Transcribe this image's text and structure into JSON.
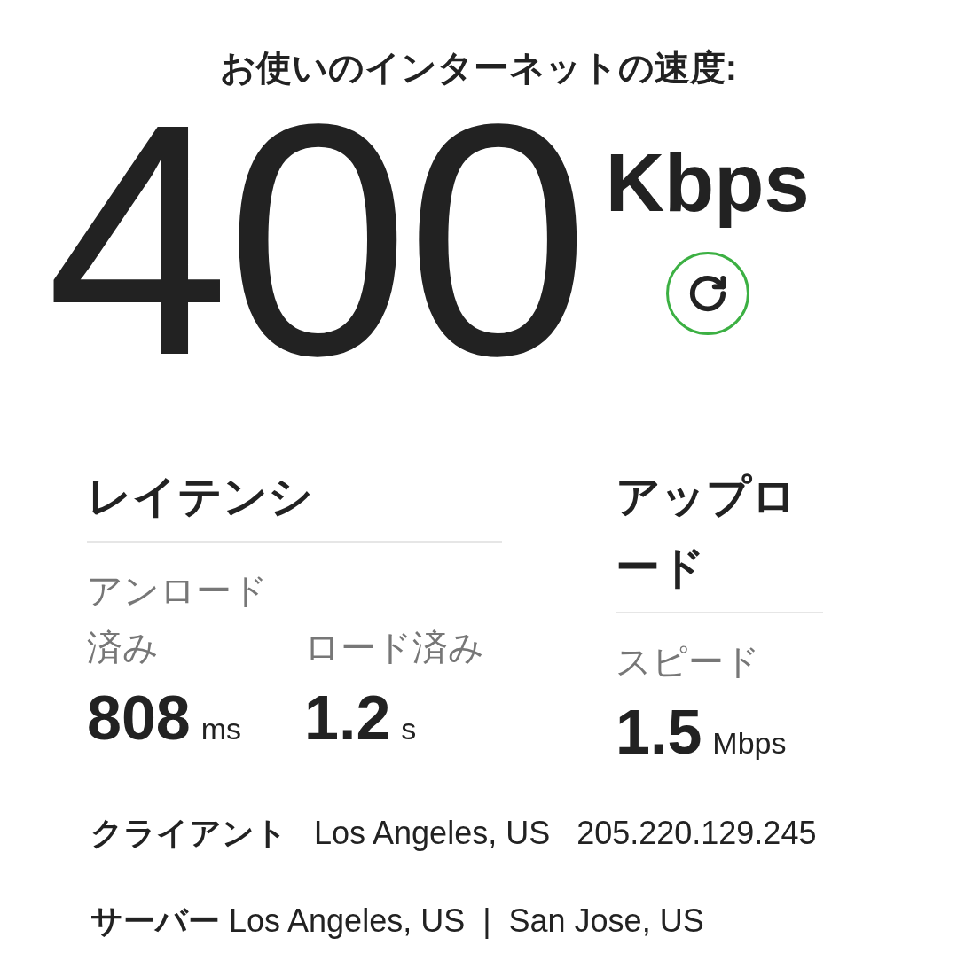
{
  "title": "お使いのインターネットの速度:",
  "speed": {
    "value": "400",
    "unit": "Kbps"
  },
  "latency": {
    "heading": "レイテンシ",
    "metrics": [
      {
        "label": "アンロード済み",
        "value": "808",
        "unit": "ms"
      },
      {
        "label": "ロード済み",
        "value": "1.2",
        "unit": "s"
      }
    ]
  },
  "upload": {
    "heading": "アップロード",
    "metrics": [
      {
        "label": "スピード",
        "value": "1.5",
        "unit": "Mbps"
      }
    ]
  },
  "client": {
    "label": "クライアント",
    "location": "Los Angeles, US",
    "ip": "205.220.129.245"
  },
  "server": {
    "label": "サーバー",
    "text": "Los Angeles, US  |  San Jose, US"
  }
}
